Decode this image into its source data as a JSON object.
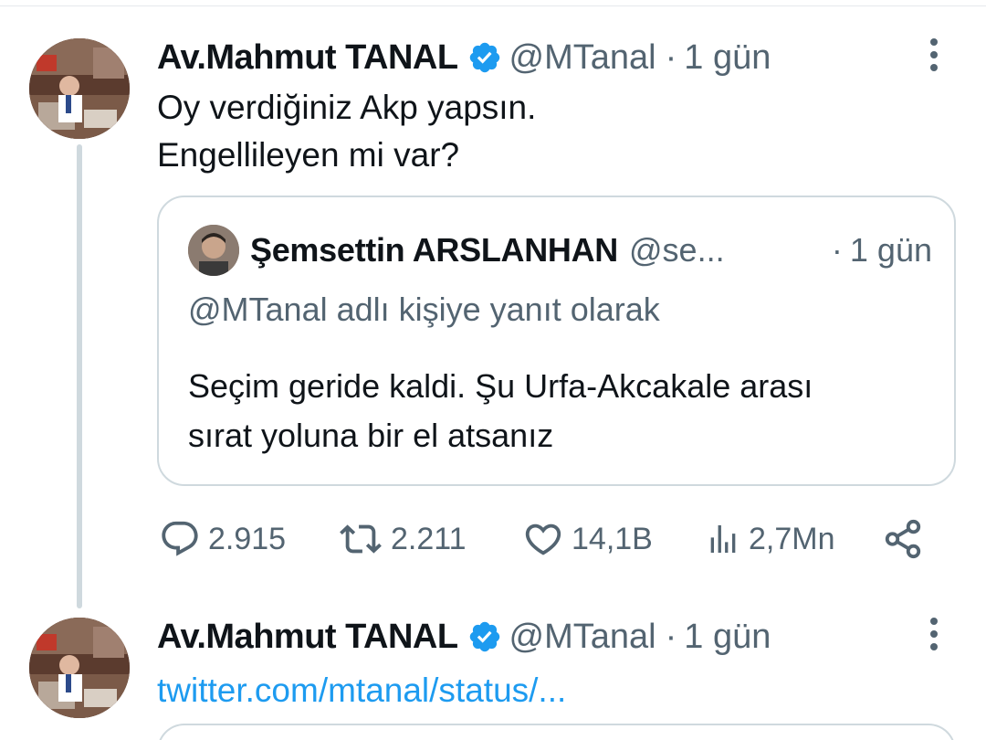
{
  "tweets": [
    {
      "author_name": "Av.Mahmut TANAL",
      "handle": "@MTanal",
      "separator": "·",
      "time": "1 gün",
      "text_line1": "Oy verdiğiniz Akp yapsın.",
      "text_line2": "Engellileyen mi var?",
      "quoted": {
        "author_name": "Şemsettin ARSLANHAN",
        "handle": "@se...",
        "separator": "·",
        "time": "1 gün",
        "reply_context": "@MTanal adlı kişiye yanıt olarak",
        "text_line1": "Seçim geride kaldi. Şu Urfa-Akcakale arası",
        "text_line2": "sırat yoluna bir el atsanız"
      },
      "stats": {
        "replies": "2.915",
        "retweets": "2.211",
        "likes": "14,1B",
        "views": "2,7Mn"
      }
    },
    {
      "author_name": "Av.Mahmut TANAL",
      "handle": "@MTanal",
      "separator": "·",
      "time": "1 gün",
      "link": "twitter.com/mtanal/status/..."
    }
  ],
  "icons": {
    "verified": "verified-badge-icon",
    "more": "more-vertical-icon",
    "reply": "reply-icon",
    "retweet": "retweet-icon",
    "like": "heart-icon",
    "views": "analytics-icon",
    "share": "share-icon"
  },
  "colors": {
    "accent": "#1d9bf0",
    "text": "#0f1419",
    "secondary": "#536471",
    "border": "#cfd9de"
  }
}
